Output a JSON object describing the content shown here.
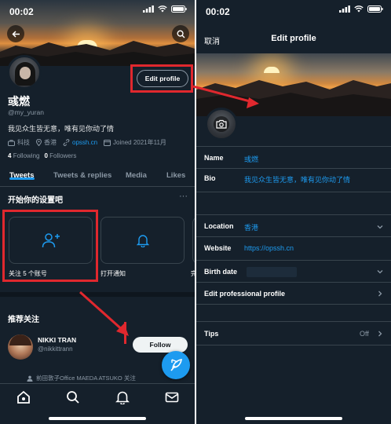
{
  "status_left": {
    "time": "00:02"
  },
  "status_right": {
    "time": "00:02"
  },
  "profile": {
    "name": "彧燃",
    "handle": "@my_yuran",
    "bio": "我见众生皆无意，唯有见你动了情",
    "meta": {
      "category": "科技",
      "location": "香港",
      "website": "opssh.cn",
      "joined": "Joined 2021年11月"
    },
    "following_count": "4",
    "following_label": "Following",
    "followers_count": "0",
    "followers_label": "Followers",
    "edit_profile_label": "Edit profile"
  },
  "tabs": [
    "Tweets",
    "Tweets & replies",
    "Media",
    "Likes"
  ],
  "setup": {
    "title": "开始你的设置吧",
    "more": "···",
    "cards": [
      "关注 5 个账号",
      "打开通知",
      "完"
    ]
  },
  "suggestions": {
    "title": "推荐关注",
    "user": {
      "name": "NIKKI TRAN",
      "handle": "@nikkittrann",
      "follow_label": "Follow"
    },
    "mutual": "前田敦子Office MAEDA ATSUKO 关注"
  },
  "bottom_nav": [
    "home-icon",
    "search-icon",
    "bell-icon",
    "mail-icon"
  ],
  "edit_profile": {
    "cancel": "取消",
    "title": "Edit profile",
    "fields": {
      "name_label": "Name",
      "name_value": "彧燃",
      "bio_label": "Bio",
      "bio_value": "我见众生皆无意，唯有见你动了情",
      "location_label": "Location",
      "location_value": "香港",
      "website_label": "Website",
      "website_value": "https://opssh.cn",
      "birth_label": "Birth date",
      "professional_label": "Edit professional profile",
      "tips_label": "Tips",
      "tips_value": "Off"
    }
  },
  "colors": {
    "background": "#15202b",
    "accent": "#1d9bf0",
    "annotation": "#e0282e",
    "border": "#38444d"
  }
}
